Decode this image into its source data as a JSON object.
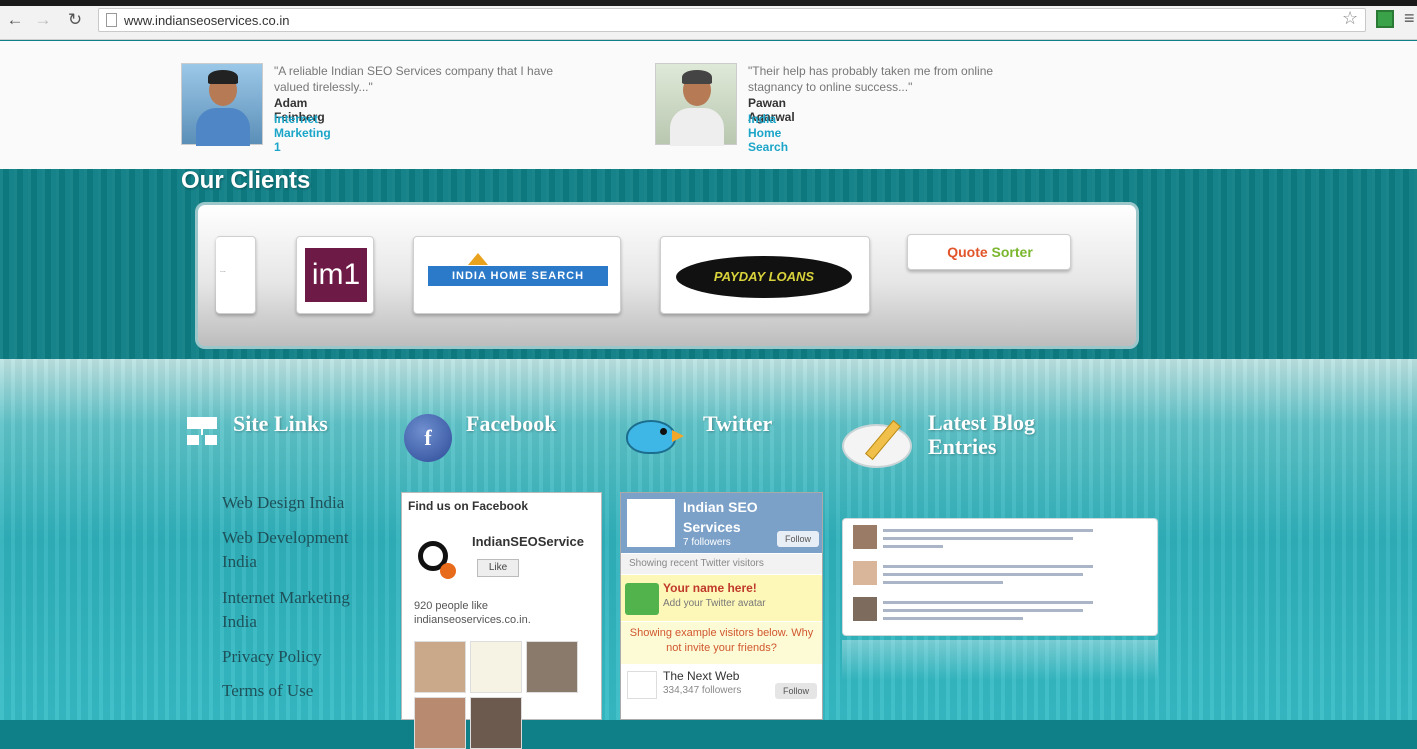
{
  "browser": {
    "url": "www.indianseoservices.co.in",
    "back_icon": "back-arrow-icon",
    "forward_icon": "forward-arrow-icon",
    "reload_icon": "reload-icon",
    "star_icon": "bookmark-star-icon",
    "menu_icon": "menu-icon"
  },
  "testimonials": [
    {
      "quote": "\"A reliable Indian SEO Services company that I have valued tirelessly...\"",
      "name": "Adam Feinberg",
      "company": "Internet Marketing 1"
    },
    {
      "quote": "\"Their help has probably taken me from online stagnancy to online success...\"",
      "name": "Pawan Agarwal",
      "company": "India Home Search"
    }
  ],
  "clients": {
    "title": "Our Clients",
    "logos": [
      {
        "name": "partial-logo",
        "text": "..."
      },
      {
        "name": "im1",
        "text": "im1"
      },
      {
        "name": "india-home-search",
        "text": "INDIA HOME SEARCH"
      },
      {
        "name": "payday-loans",
        "text": "PAYDAY LOANS"
      },
      {
        "name": "quote-sorter",
        "text_a": "Quote",
        "text_b": "Sorter"
      }
    ]
  },
  "footer": {
    "site_links": {
      "title": "Site Links",
      "links": [
        "Web Design India",
        "Web Development India",
        "Internet Marketing India",
        "Privacy Policy",
        "Terms of Use"
      ]
    },
    "facebook": {
      "title": "Facebook",
      "header": "Find us on Facebook",
      "page_name": "IndianSEOService",
      "like": "Like",
      "count": "920 people like indianseoservices.co.in."
    },
    "twitter": {
      "title": "Twitter",
      "account": "Indian SEO Services",
      "followers": "7 followers",
      "follow": "Follow",
      "subheader": "Showing recent Twitter visitors",
      "cta_title": "Your name here!",
      "cta_sub": "Add your Twitter avatar",
      "message": "Showing example visitors below. Why not invite your friends?",
      "visitor_name": "The Next Web",
      "visitor_followers": "334,347 followers",
      "visitor_follow": "Follow"
    },
    "blog": {
      "title": "Latest Blog Entries",
      "title_line1": "Latest Blog",
      "title_line2": "Entries"
    }
  },
  "colors": {
    "teal_band": "#0e7f86",
    "footer_teal": "#2fb1bb",
    "link_blue": "#1ba5c8"
  }
}
